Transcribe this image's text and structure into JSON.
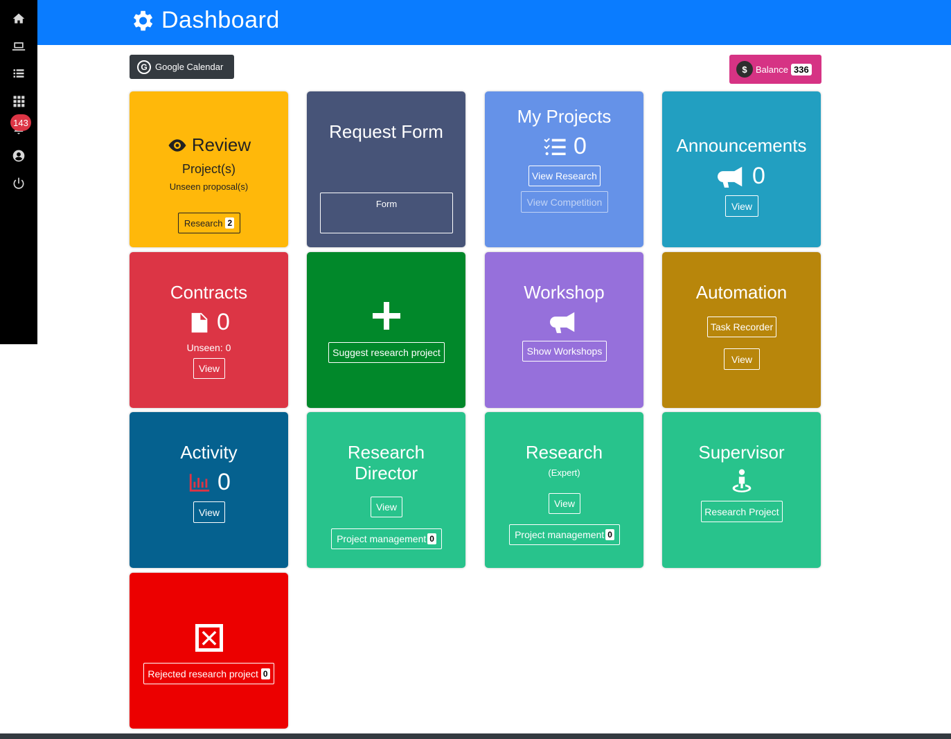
{
  "header": {
    "title": "Dashboard"
  },
  "sidebar": {
    "notification_count": "143"
  },
  "toolbar": {
    "google_calendar_label": "Google Calendar",
    "balance_label": "Balance",
    "balance_value": "336"
  },
  "cards": {
    "review": {
      "title": "Review",
      "subtitle": "Project(s)",
      "note": "Unseen proposal(s)",
      "button_label": "Research",
      "button_count": "2",
      "color": "#ffb80a"
    },
    "request_form": {
      "title": "Request Form",
      "button_label": "Form",
      "color": "#475478"
    },
    "my_projects": {
      "title": "My Projects",
      "count": "0",
      "view_research_label": "View Research",
      "view_competition_label": "View Competition",
      "color": "#6592e8"
    },
    "announcements": {
      "title": "Announcements",
      "count": "0",
      "view_label": "View",
      "color": "#229fc1"
    },
    "contracts": {
      "title": "Contracts",
      "count": "0",
      "unseen_label": "Unseen: 0",
      "view_label": "View",
      "color": "#dc3545"
    },
    "suggest": {
      "button_label": "Suggest research project",
      "color": "#01882a"
    },
    "workshop": {
      "title": "Workshop",
      "button_label": "Show Workshops",
      "color": "#9670db"
    },
    "automation": {
      "title": "Automation",
      "task_recorder_label": "Task Recorder",
      "view_label": "View",
      "color": "#b8860b"
    },
    "activity": {
      "title": "Activity",
      "count": "0",
      "view_label": "View",
      "color": "#05618f"
    },
    "research_director": {
      "title_line1": "Research",
      "title_line2": "Director",
      "view_label": "View",
      "pm_label": "Project management",
      "pm_count": "0",
      "color": "#28c38c"
    },
    "research_expert": {
      "title": "Research",
      "subtitle": "(Expert)",
      "view_label": "View",
      "pm_label": "Project management",
      "pm_count": "0",
      "color": "#28c38c"
    },
    "supervisor": {
      "title": "Supervisor",
      "button_label": "Research Project",
      "color": "#28c38c"
    },
    "rejected": {
      "button_label": "Rejected research project",
      "count": "0",
      "color": "#ec0000"
    }
  }
}
